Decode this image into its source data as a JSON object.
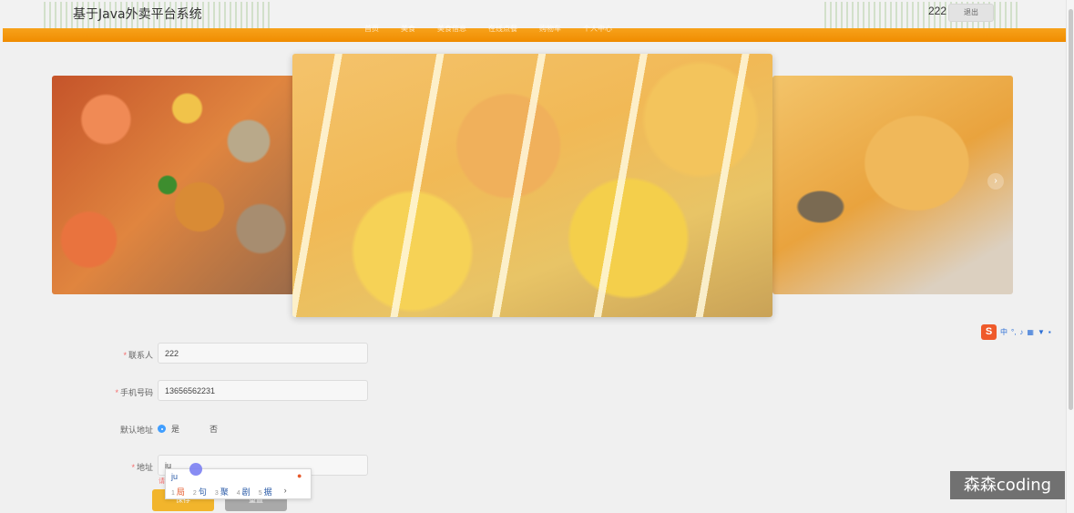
{
  "header": {
    "app_title": "基于Java外卖平台系统",
    "user_name": "222",
    "logout_label": "退出",
    "nav_items": [
      "首页",
      "美食",
      "美食信息",
      "在线点餐",
      "购物车",
      "个人中心"
    ]
  },
  "carousel": {
    "slides": [
      "seafood-hotpot",
      "pineapple-shrimp",
      "egg-tart-pastry"
    ],
    "next_icon": "chevron-right-icon"
  },
  "form": {
    "contact": {
      "label": "联系人",
      "value": "222"
    },
    "phone": {
      "label": "手机号码",
      "value": "13656562231"
    },
    "default_address": {
      "label": "默认地址",
      "options": [
        "是",
        "否"
      ],
      "selected": "是"
    },
    "address": {
      "label": "地址",
      "value": "ju"
    },
    "error_hint": "请",
    "save_label": "保存",
    "reset_label": "重置"
  },
  "ime": {
    "pinyin": "ju",
    "candidates": [
      {
        "num": "1",
        "text": "局"
      },
      {
        "num": "2",
        "text": "句"
      },
      {
        "num": "3",
        "text": "聚"
      },
      {
        "num": "4",
        "text": "剧"
      },
      {
        "num": "5",
        "text": "据"
      }
    ],
    "next": "›",
    "toolbar_lang": "中"
  },
  "watermark": "森森coding",
  "colors": {
    "accent": "#f08c00",
    "primary": "#409eff",
    "save": "#f2b52c"
  }
}
